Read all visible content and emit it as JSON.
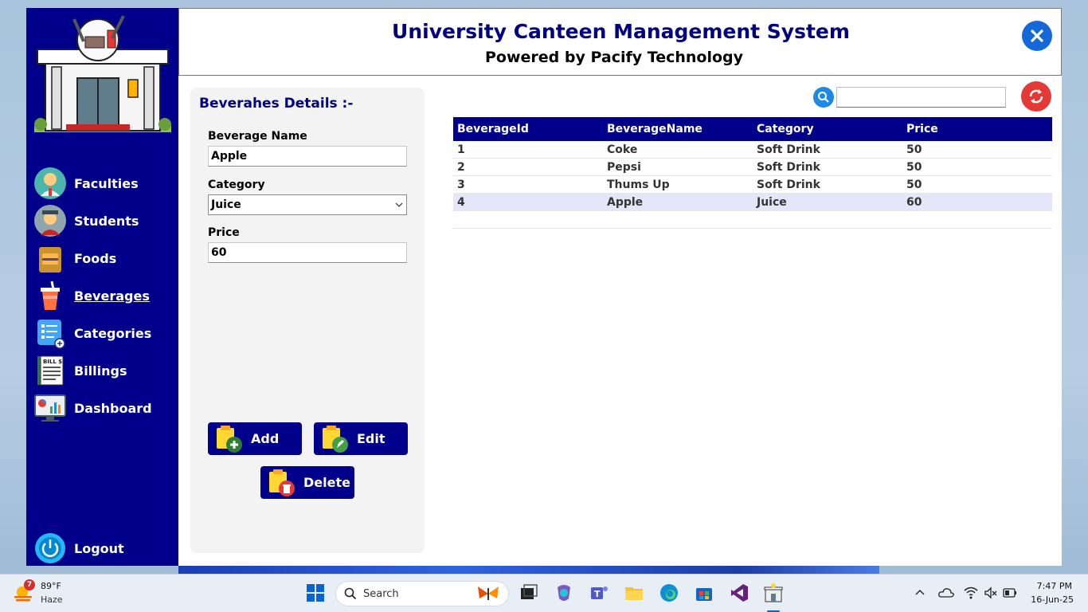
{
  "header": {
    "title": "University Canteen Management System",
    "subtitle": "Powered by Pacify Technology"
  },
  "sidebar": {
    "items": [
      {
        "label": "Faculties",
        "icon": "faculty-icon"
      },
      {
        "label": "Students",
        "icon": "student-icon"
      },
      {
        "label": "Foods",
        "icon": "food-icon"
      },
      {
        "label": "Beverages",
        "icon": "beverage-icon",
        "active": true
      },
      {
        "label": "Categories",
        "icon": "categories-icon"
      },
      {
        "label": "Billings",
        "icon": "bill-icon"
      },
      {
        "label": "Dashboard",
        "icon": "dashboard-icon"
      }
    ],
    "logout_label": "Logout"
  },
  "form": {
    "title": "Beverahes Details :-",
    "name_label": "Beverage Name",
    "name_value": "Apple",
    "category_label": "Category",
    "category_value": "Juice",
    "price_label": "Price",
    "price_value": "60",
    "add_label": "Add",
    "edit_label": "Edit",
    "delete_label": "Delete"
  },
  "search": {
    "value": ""
  },
  "table": {
    "columns": [
      "BeverageId",
      "BeverageName",
      "Category",
      "Price"
    ],
    "rows": [
      [
        "1",
        "Coke",
        "Soft Drink",
        "50"
      ],
      [
        "2",
        "Pepsi",
        "Soft Drink",
        "50"
      ],
      [
        "3",
        "Thums Up",
        "Soft Drink",
        "50"
      ],
      [
        "4",
        "Apple",
        "Juice",
        "60"
      ]
    ],
    "selected_row": 3
  },
  "taskbar": {
    "badge": "7",
    "temperature": "89°F",
    "weather": "Haze",
    "search_label": "Search",
    "time": "7:47 PM",
    "date": "16-Jun-25"
  },
  "colors": {
    "sidebar": "#00008b",
    "title": "#000080",
    "close": "#1468d8",
    "refresh": "#e53935",
    "selected_row": "#e6e6fa"
  }
}
